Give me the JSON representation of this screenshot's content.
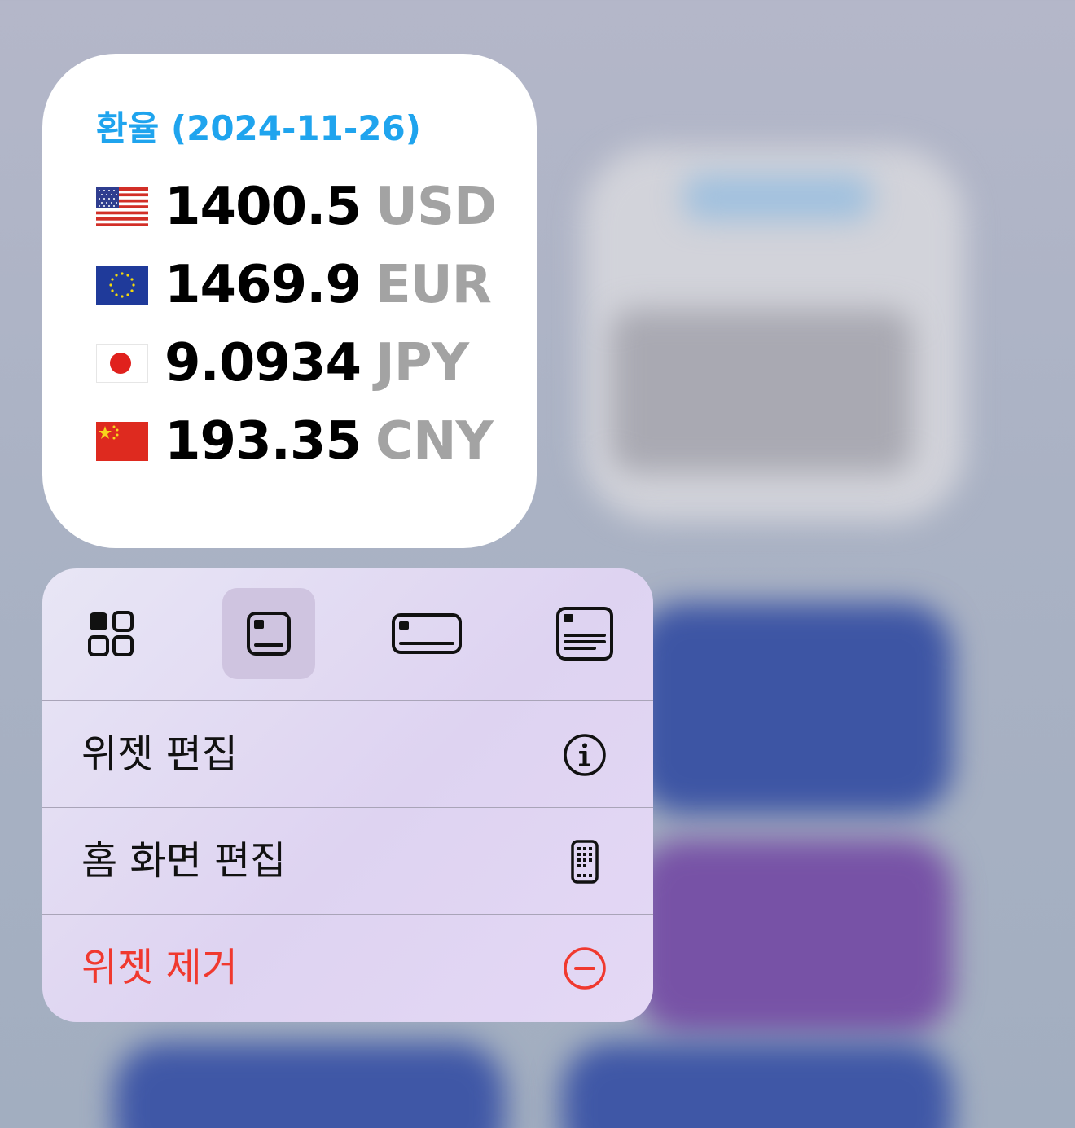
{
  "widget": {
    "title": "환율 (2024-11-26)",
    "rates": [
      {
        "flag": "us-flag-icon",
        "value": "1400.5",
        "code": "USD"
      },
      {
        "flag": "eu-flag-icon",
        "value": "1469.9",
        "code": "EUR"
      },
      {
        "flag": "jp-flag-icon",
        "value": "9.0934",
        "code": "JPY"
      },
      {
        "flag": "cn-flag-icon",
        "value": "193.35",
        "code": "CNY"
      }
    ]
  },
  "menu": {
    "sizes": [
      {
        "icon": "small-widget-size-icon",
        "selected": false
      },
      {
        "icon": "medium-widget-size-icon",
        "selected": true
      },
      {
        "icon": "wide-widget-size-icon",
        "selected": false
      },
      {
        "icon": "large-widget-size-icon",
        "selected": false
      }
    ],
    "items": [
      {
        "label": "위젯 편집",
        "icon": "info-circle-icon"
      },
      {
        "label": "홈 화면 편집",
        "icon": "phone-apps-icon"
      },
      {
        "label": "위젯 제거",
        "icon": "minus-circle-icon",
        "danger": true
      }
    ]
  },
  "colors": {
    "title_accent": "#1fa4ee",
    "danger": "#f0392f",
    "code_gray": "#a3a3a3"
  }
}
